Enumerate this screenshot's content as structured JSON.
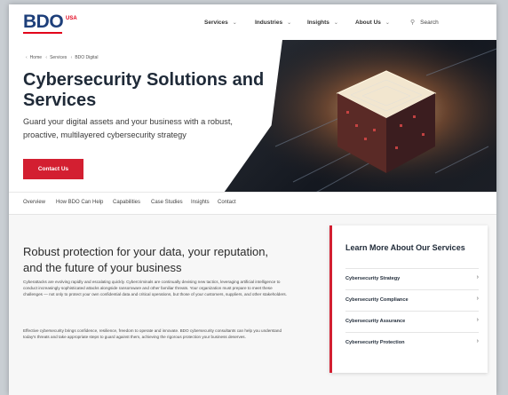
{
  "header": {
    "logo": "BDO",
    "logo_region": "USA",
    "nav": [
      {
        "label": "Services"
      },
      {
        "label": "Industries"
      },
      {
        "label": "Insights"
      },
      {
        "label": "About Us"
      }
    ],
    "search_label": "Search"
  },
  "hero": {
    "breadcrumb": [
      "Home",
      "Services",
      "BDO Digital"
    ],
    "title": "Cybersecurity Solutions and Services",
    "subtitle": "Guard your digital assets and your business with a robust, proactive, multilayered cybersecurity strategy",
    "cta_label": "Contact Us"
  },
  "section_nav": [
    "Overview",
    "How BDO Can Help",
    "Capabilities",
    "Case Studies",
    "Insights",
    "Contact"
  ],
  "main": {
    "heading": "Robust protection for your data, your reputation, and the future of your business",
    "paragraph1": "Cyberattacks are evolving rapidly and escalating quickly. Cybercriminals are continually devising new tactics, leveraging artificial intelligence to conduct increasingly sophisticated attacks alongside ransomware and other familiar threats. Your organization must prepare to meet these challenges — not only to protect your own confidential data and critical operations, but those of your customers, suppliers, and other stakeholders.",
    "paragraph2": "Effective cybersecurity brings confidence, resilience, freedom to operate and innovate. BDO cybersecurity consultants can help you understand today's threats and take appropriate steps to guard against them, achieving the rigorous protection your business deserves."
  },
  "sidebar": {
    "title": "Learn More About Our Services",
    "items": [
      {
        "label": "Cybersecurity Strategy"
      },
      {
        "label": "Cybersecurity Compliance"
      },
      {
        "label": "Cybersecurity Assurance"
      },
      {
        "label": "Cybersecurity Protection"
      }
    ]
  },
  "colors": {
    "brand_blue": "#1d3f7a",
    "accent_red": "#d31f31"
  }
}
